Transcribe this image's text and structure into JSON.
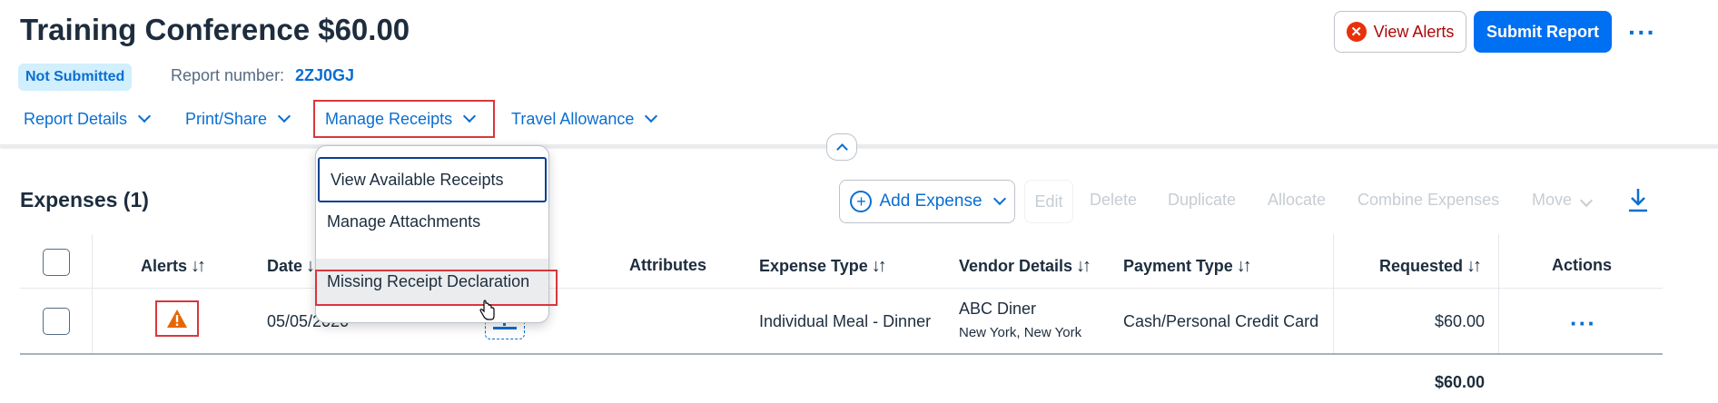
{
  "header": {
    "title": "Training Conference $60.00",
    "status": "Not Submitted",
    "report_number_label": "Report number:",
    "report_number": "2ZJ0GJ",
    "view_alerts_label": "View Alerts",
    "submit_label": "Submit Report"
  },
  "tabs": [
    {
      "label": "Report Details"
    },
    {
      "label": "Print/Share"
    },
    {
      "label": "Manage Receipts"
    },
    {
      "label": "Travel Allowance"
    }
  ],
  "dropdown": {
    "items": [
      {
        "label": "View Available Receipts"
      },
      {
        "label": "Manage Attachments"
      },
      {
        "label": "Missing Receipt Declaration"
      }
    ]
  },
  "expenses": {
    "title": "Expenses (1)",
    "toolbar": {
      "add_expense": "Add Expense",
      "edit": "Edit",
      "delete": "Delete",
      "duplicate": "Duplicate",
      "allocate": "Allocate",
      "combine": "Combine Expenses",
      "move": "Move"
    },
    "columns": {
      "alerts": "Alerts",
      "date": "Date",
      "attributes": "Attributes",
      "expense_type": "Expense Type",
      "vendor_details": "Vendor Details",
      "payment_type": "Payment Type",
      "requested": "Requested",
      "actions": "Actions"
    },
    "rows": [
      {
        "date": "05/05/2020",
        "expense_type": "Individual Meal - Dinner",
        "vendor": "ABC Diner",
        "vendor_location": "New York, New York",
        "payment_type": "Cash/Personal Credit Card",
        "requested": "$60.00"
      }
    ],
    "total": "$60.00"
  },
  "colors": {
    "accent": "#0a6ed1",
    "primary_button": "#0070f2",
    "alert_red": "#e9300b",
    "warning_orange": "#e76500",
    "highlight": "#d9363e"
  }
}
